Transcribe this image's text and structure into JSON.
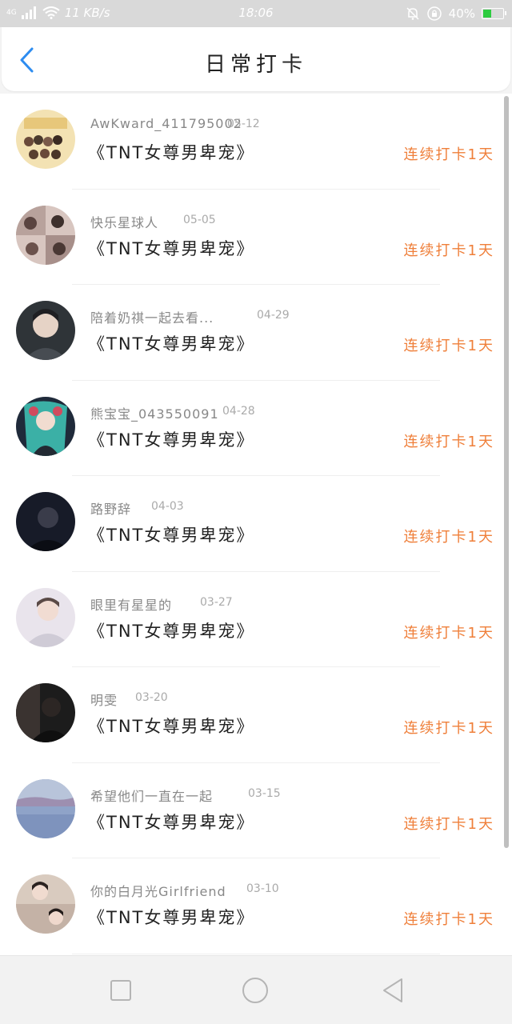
{
  "status_bar": {
    "network": "4G",
    "speed": "11 KB/s",
    "time": "18:06",
    "battery_percent": "40%",
    "battery_color": "#2ecc40"
  },
  "header": {
    "title": "日常打卡",
    "back_icon": "chevron-left-icon",
    "accent_color": "#2d8cf0"
  },
  "list": {
    "accent_color": "#ef7f3a",
    "items": [
      {
        "username": "AwKward_411795002",
        "date": "05-12",
        "title": "《TNT女尊男卑宠》",
        "streak": "连续打卡1天"
      },
      {
        "username": "快乐星球人",
        "date": "05-05",
        "title": "《TNT女尊男卑宠》",
        "streak": "连续打卡1天"
      },
      {
        "username": "陪着奶祺一起去看...",
        "date": "04-29",
        "title": "《TNT女尊男卑宠》",
        "streak": "连续打卡1天"
      },
      {
        "username": "熊宝宝_043550091",
        "date": "04-28",
        "title": "《TNT女尊男卑宠》",
        "streak": "连续打卡1天"
      },
      {
        "username": "路野辞",
        "date": "04-03",
        "title": "《TNT女尊男卑宠》",
        "streak": "连续打卡1天"
      },
      {
        "username": "眼里有星星的",
        "date": "03-27",
        "title": "《TNT女尊男卑宠》",
        "streak": "连续打卡1天"
      },
      {
        "username": "明雯",
        "date": "03-20",
        "title": "《TNT女尊男卑宠》",
        "streak": "连续打卡1天"
      },
      {
        "username": "希望他们一直在一起",
        "date": "03-15",
        "title": "《TNT女尊男卑宠》",
        "streak": "连续打卡1天"
      },
      {
        "username": "你的白月光Girlfriend",
        "date": "03-10",
        "title": "《TNT女尊男卑宠》",
        "streak": "连续打卡1天"
      }
    ]
  },
  "nav_bar": {
    "icons": [
      "square-icon",
      "circle-icon",
      "triangle-back-icon"
    ]
  }
}
